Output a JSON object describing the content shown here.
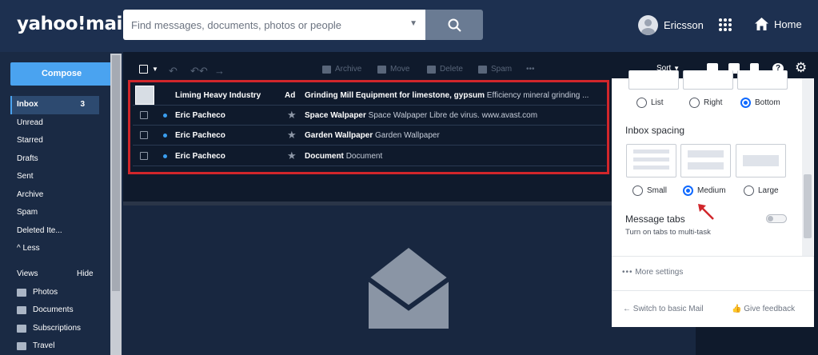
{
  "header": {
    "logo": "yahoo!mail",
    "search_placeholder": "Find messages, documents, photos or people",
    "user_name": "Ericsson",
    "home_label": "Home"
  },
  "sidebar": {
    "compose": "Compose",
    "items": [
      {
        "label": "Inbox",
        "count": "3"
      },
      {
        "label": "Unread"
      },
      {
        "label": "Starred"
      },
      {
        "label": "Drafts"
      },
      {
        "label": "Sent"
      },
      {
        "label": "Archive"
      },
      {
        "label": "Spam"
      },
      {
        "label": "Deleted Ite..."
      },
      {
        "label": "^ Less"
      }
    ],
    "views_label": "Views",
    "hide_label": "Hide",
    "views": [
      "Photos",
      "Documents",
      "Subscriptions",
      "Travel"
    ]
  },
  "toolbar": {
    "archive": "Archive",
    "move": "Move",
    "delete": "Delete",
    "spam": "Spam",
    "more": "•••",
    "sort": "Sort"
  },
  "messages": [
    {
      "from": "Liming Heavy Industry",
      "badge": "Ad",
      "subject": "Grinding Mill Equipment for limestone, gypsum",
      "snippet": "Efficiency mineral grinding ..."
    },
    {
      "from": "Eric Pacheco",
      "subject": "Space Walpaper",
      "snippet": "Space Walpaper Libre de virus. www.avast.com"
    },
    {
      "from": "Eric Pacheco",
      "subject": "Garden Wallpaper",
      "snippet": "Garden Wallpaper"
    },
    {
      "from": "Eric Pacheco",
      "subject": "Document",
      "snippet": "Document"
    }
  ],
  "settings": {
    "pane_options": [
      "List",
      "Right",
      "Bottom"
    ],
    "pane_selected": "Bottom",
    "spacing_title": "Inbox spacing",
    "spacing_options": [
      "Small",
      "Medium",
      "Large"
    ],
    "spacing_selected": "Medium",
    "tabs_title": "Message tabs",
    "tabs_desc": "Turn on tabs to multi-task",
    "tabs_enabled": false,
    "more_settings": "More settings",
    "basic_mail": "Switch to basic Mail",
    "feedback": "Give feedback"
  },
  "colors": {
    "accent": "#0f69ff",
    "highlight_box": "#d1262b",
    "compose": "#4aa3f0"
  }
}
